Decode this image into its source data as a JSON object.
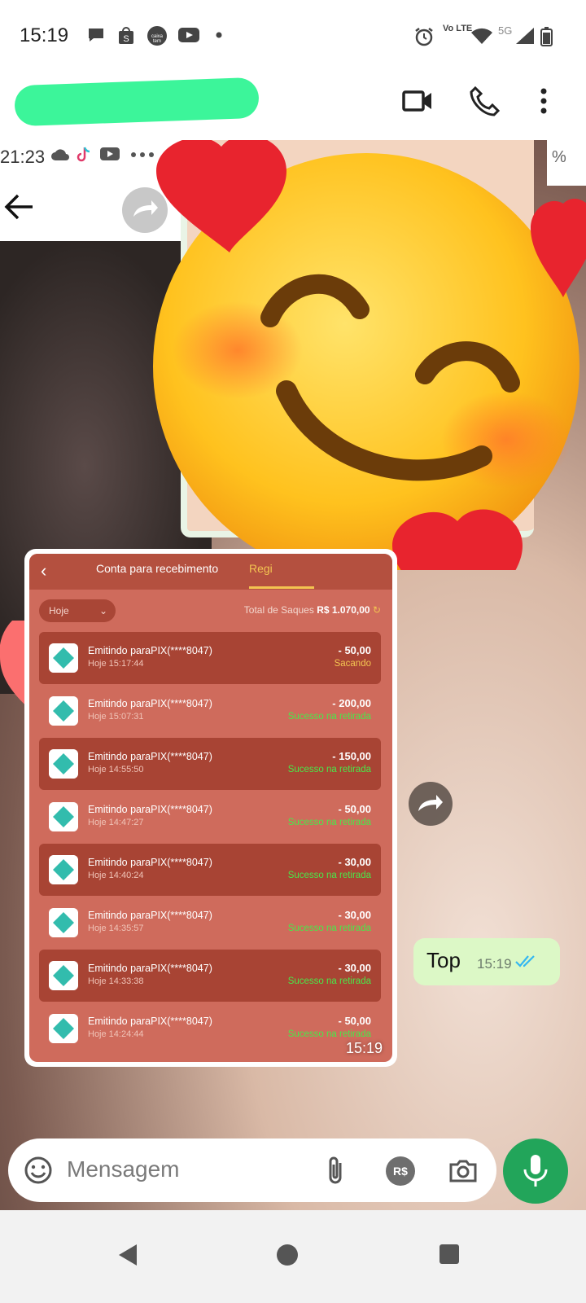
{
  "status_bar": {
    "time": "15:19",
    "notification_icons": [
      "message-bubble-icon",
      "shopee-icon",
      "caixa-tem-icon",
      "youtube-icon",
      "dot-icon"
    ],
    "system_icons": [
      "alarm-icon",
      "volte-icon",
      "wifi-icon",
      "5g-signal-icon",
      "battery-icon"
    ],
    "network_label": "5G",
    "volte_label": "Vo LTE"
  },
  "app_bar": {
    "contact_name_redacted": true,
    "actions": [
      "video-call-icon",
      "phone-call-icon",
      "more-vert-icon"
    ]
  },
  "forwarded_screenshot": {
    "time": "21:23",
    "left_header_icons": [
      "cloud-icon",
      "tiktok-icon",
      "youtube-icon",
      "ellipsis-icon"
    ],
    "right_header_text": "%"
  },
  "image_message": {
    "time": "15:19",
    "screenshot": {
      "tab_active_prev": "Conta para recebimento",
      "tab_partial": "Regi",
      "filter_label": "Hoje",
      "total_label": "Total de Saques",
      "total_value": "R$ 1.070,00",
      "transactions": [
        {
          "title": "Emitindo paraPIX(****8047)",
          "date": "Hoje 15:17:44",
          "amount": "- 50,00",
          "status": "Sacando",
          "status_type": "pending"
        },
        {
          "title": "Emitindo paraPIX(****8047)",
          "date": "Hoje 15:07:31",
          "amount": "- 200,00",
          "status": "Sucesso na retirada",
          "status_type": "success"
        },
        {
          "title": "Emitindo paraPIX(****8047)",
          "date": "Hoje 14:55:50",
          "amount": "- 150,00",
          "status": "Sucesso na retirada",
          "status_type": "success"
        },
        {
          "title": "Emitindo paraPIX(****8047)",
          "date": "Hoje 14:47:27",
          "amount": "- 50,00",
          "status": "Sucesso na retirada",
          "status_type": "success"
        },
        {
          "title": "Emitindo paraPIX(****8047)",
          "date": "Hoje 14:40:24",
          "amount": "- 30,00",
          "status": "Sucesso na retirada",
          "status_type": "success"
        },
        {
          "title": "Emitindo paraPIX(****8047)",
          "date": "Hoje 14:35:57",
          "amount": "- 30,00",
          "status": "Sucesso na retirada",
          "status_type": "success"
        },
        {
          "title": "Emitindo paraPIX(****8047)",
          "date": "Hoje 14:33:38",
          "amount": "- 30,00",
          "status": "Sucesso na retirada",
          "status_type": "success"
        },
        {
          "title": "Emitindo paraPIX(****8047)",
          "date": "Hoje 14:24:44",
          "amount": "- 50,00",
          "status": "Sucesso na retirada",
          "status_type": "success"
        }
      ]
    }
  },
  "sent_message": {
    "text": "Top",
    "time": "15:19",
    "read_status": "double-check-icon"
  },
  "composer": {
    "placeholder": "Mensagem",
    "icons": [
      "emoji-icon",
      "attach-icon",
      "payment-icon",
      "camera-icon",
      "mic-icon"
    ],
    "payment_label": "R$"
  },
  "nav_bar": {
    "icons": [
      "back-icon",
      "home-icon",
      "recents-icon"
    ]
  },
  "colors": {
    "whatsapp_green": "#22a55a",
    "sent_bubble": "#dcf8c6",
    "screenshot_bg": "#cf6b5c",
    "screenshot_row_dark": "#a84434",
    "success_text": "#49e84a",
    "pending_text": "#f3c451",
    "read_tick": "#34b7f1"
  }
}
